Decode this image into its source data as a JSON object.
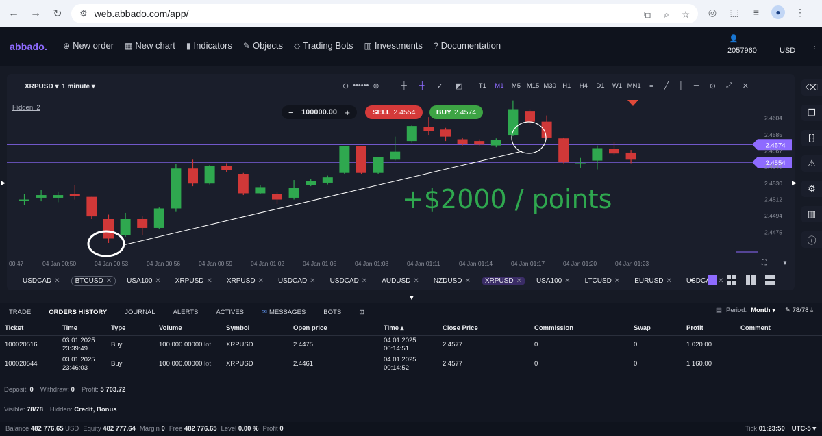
{
  "browser": {
    "url": "web.abbado.com/app/"
  },
  "app": {
    "logo": "abbado.",
    "menu": [
      {
        "icon": "⊕",
        "label": "New order"
      },
      {
        "icon": "▦",
        "label": "New chart"
      },
      {
        "icon": "▮",
        "label": "Indicators"
      },
      {
        "icon": "✎",
        "label": "Objects"
      },
      {
        "icon": "◇",
        "label": "Trading Bots"
      },
      {
        "icon": "▥",
        "label": "Investments"
      },
      {
        "icon": "?",
        "label": "Documentation"
      }
    ],
    "account_id": "2057960",
    "currency": "USD"
  },
  "chart": {
    "symbol": "XRPUSD",
    "interval": "1 minute",
    "timeframes": [
      "T1",
      "M1",
      "M5",
      "M15",
      "M30",
      "H1",
      "H4",
      "D1",
      "W1",
      "MN1"
    ],
    "selected_timeframe": "M1",
    "hidden_label": "Hidden: 2",
    "lot": "100000.00",
    "sell_label": "SELL",
    "sell_price": "2.4554",
    "buy_label": "BUY",
    "buy_price": "2.4574",
    "annotation": "+$2000 / points",
    "colors": {
      "up": "#2fa84f",
      "down": "#d03838",
      "line": "#8e6bff"
    }
  },
  "chart_data": {
    "type": "candlestick",
    "title": "",
    "x_ticks": [
      "00:47",
      "04 Jan 00:50",
      "04 Jan 00:53",
      "04 Jan 00:56",
      "04 Jan 00:59",
      "04 Jan 01:02",
      "04 Jan 01:05",
      "04 Jan 01:08",
      "04 Jan 01:11",
      "04 Jan 01:14",
      "04 Jan 01:17",
      "04 Jan 01:20",
      "04 Jan 01:23"
    ],
    "y_ticks": [
      "2.4604",
      "2.4585",
      "2.4567",
      "2.4549",
      "2.4530",
      "2.4512",
      "2.4494",
      "2.4475"
    ],
    "price_lines": [
      {
        "label": "2.4574",
        "value": 2.4574
      },
      {
        "label": "2.4554",
        "value": 2.4554
      }
    ],
    "candles": [
      {
        "o": 2.4512,
        "c": 2.4512,
        "h": 2.4518,
        "l": 2.4506
      },
      {
        "o": 2.4514,
        "c": 2.4517,
        "h": 2.4523,
        "l": 2.451
      },
      {
        "o": 2.4514,
        "c": 2.4517,
        "h": 2.4521,
        "l": 2.4509
      },
      {
        "o": 2.4518,
        "c": 2.4516,
        "h": 2.4528,
        "l": 2.4512
      },
      {
        "o": 2.4515,
        "c": 2.4493,
        "h": 2.4515,
        "l": 2.449
      },
      {
        "o": 2.449,
        "c": 2.4468,
        "h": 2.4495,
        "l": 2.4463
      },
      {
        "o": 2.4472,
        "c": 2.449,
        "h": 2.4497,
        "l": 2.447
      },
      {
        "o": 2.449,
        "c": 2.448,
        "h": 2.4493,
        "l": 2.4472
      },
      {
        "o": 2.448,
        "c": 2.4502,
        "h": 2.4503,
        "l": 2.4479
      },
      {
        "o": 2.4502,
        "c": 2.4547,
        "h": 2.4552,
        "l": 2.4498
      },
      {
        "o": 2.4547,
        "c": 2.453,
        "h": 2.4557,
        "l": 2.4527
      },
      {
        "o": 2.453,
        "c": 2.455,
        "h": 2.4551,
        "l": 2.4529
      },
      {
        "o": 2.455,
        "c": 2.4545,
        "h": 2.4553,
        "l": 2.4543
      },
      {
        "o": 2.4541,
        "c": 2.4519,
        "h": 2.4542,
        "l": 2.4517
      },
      {
        "o": 2.4519,
        "c": 2.4526,
        "h": 2.4528,
        "l": 2.4518
      },
      {
        "o": 2.4518,
        "c": 2.4512,
        "h": 2.452,
        "l": 2.4507
      },
      {
        "o": 2.4514,
        "c": 2.4525,
        "h": 2.4534,
        "l": 2.4512
      },
      {
        "o": 2.4528,
        "c": 2.4533,
        "h": 2.4535,
        "l": 2.4527
      },
      {
        "o": 2.4531,
        "c": 2.4537,
        "h": 2.4539,
        "l": 2.4529
      },
      {
        "o": 2.4542,
        "c": 2.4572,
        "h": 2.4572,
        "l": 2.4541
      },
      {
        "o": 2.4572,
        "c": 2.4542,
        "h": 2.4572,
        "l": 2.4541
      },
      {
        "o": 2.4542,
        "c": 2.456,
        "h": 2.456,
        "l": 2.4541
      },
      {
        "o": 2.4557,
        "c": 2.4566,
        "h": 2.4583,
        "l": 2.4556
      },
      {
        "o": 2.4578,
        "c": 2.4595,
        "h": 2.4596,
        "l": 2.4576
      },
      {
        "o": 2.4594,
        "c": 2.4589,
        "h": 2.4605,
        "l": 2.4585
      },
      {
        "o": 2.4591,
        "c": 2.4583,
        "h": 2.4593,
        "l": 2.4578
      },
      {
        "o": 2.458,
        "c": 2.4575,
        "h": 2.4582,
        "l": 2.4573
      },
      {
        "o": 2.4578,
        "c": 2.4574,
        "h": 2.458,
        "l": 2.4573
      },
      {
        "o": 2.4573,
        "c": 2.4579,
        "h": 2.4581,
        "l": 2.4571
      },
      {
        "o": 2.4585,
        "c": 2.4614,
        "h": 2.4624,
        "l": 2.4584
      },
      {
        "o": 2.4612,
        "c": 2.46,
        "h": 2.4614,
        "l": 2.4596
      },
      {
        "o": 2.46,
        "c": 2.4582,
        "h": 2.4607,
        "l": 2.458
      },
      {
        "o": 2.4581,
        "c": 2.4554,
        "h": 2.4582,
        "l": 2.4553
      },
      {
        "o": 2.4553,
        "c": 2.4553,
        "h": 2.4559,
        "l": 2.4548
      },
      {
        "o": 2.4556,
        "c": 2.457,
        "h": 2.4573,
        "l": 2.4546
      },
      {
        "o": 2.4569,
        "c": 2.4564,
        "h": 2.4577,
        "l": 2.4562
      },
      {
        "o": 2.4565,
        "c": 2.4557,
        "h": 2.4568,
        "l": 2.4553
      }
    ]
  },
  "symbol_tabs": [
    {
      "label": "USDCAD",
      "state": "normal"
    },
    {
      "label": "BTCUSD",
      "state": "outlined"
    },
    {
      "label": "USA100",
      "state": "normal"
    },
    {
      "label": "XRPUSD",
      "state": "normal"
    },
    {
      "label": "XRPUSD",
      "state": "normal"
    },
    {
      "label": "USDCAD",
      "state": "normal"
    },
    {
      "label": "USDCAD",
      "state": "normal"
    },
    {
      "label": "AUDUSD",
      "state": "normal"
    },
    {
      "label": "NZDUSD",
      "state": "normal"
    },
    {
      "label": "XRPUSD",
      "state": "selected"
    },
    {
      "label": "USA100",
      "state": "normal"
    },
    {
      "label": "LTCUSD",
      "state": "normal"
    },
    {
      "label": "EURUSD",
      "state": "normal"
    },
    {
      "label": "USDCAD",
      "state": "normal"
    }
  ],
  "bottom": {
    "tabs": [
      "TRADE",
      "ORDERS HISTORY",
      "JOURNAL",
      "ALERTS",
      "ACTIVES",
      "MESSAGES",
      "BOTS"
    ],
    "active_tab": "ORDERS HISTORY",
    "period_label": "Period:",
    "period_value": "Month",
    "count": "78/78",
    "columns": [
      "Ticket",
      "Time",
      "Type",
      "Volume",
      "Symbol",
      "Open price",
      "Time",
      "Close Price",
      "Commission",
      "Swap",
      "Profit",
      "Comment"
    ],
    "rows": [
      {
        "ticket": "100020516",
        "time1": "03.01.2025",
        "time2": "23:39:49",
        "type": "Buy",
        "volume": "100 000.00000",
        "lot": "lot",
        "symbol": "XRPUSD",
        "open": "2.4475",
        "ctime1": "04.01.2025",
        "ctime2": "00:14:51",
        "close": "2.4577",
        "commission": "0",
        "swap": "0",
        "profit": "1 020.00",
        "comment": ""
      },
      {
        "ticket": "100020544",
        "time1": "03.01.2025",
        "time2": "23:46:03",
        "type": "Buy",
        "volume": "100 000.00000",
        "lot": "lot",
        "symbol": "XRPUSD",
        "open": "2.4461",
        "ctime1": "04.01.2025",
        "ctime2": "00:14:52",
        "close": "2.4577",
        "commission": "0",
        "swap": "0",
        "profit": "1 160.00",
        "comment": ""
      }
    ],
    "deposit_label": "Deposit:",
    "deposit": "0",
    "withdraw_label": "Withdraw:",
    "withdraw": "0",
    "profit_label": "Profit:",
    "profit": "5 703.72",
    "visible_label": "Visible:",
    "visible": "78/78",
    "hidden_label": "Hidden:",
    "hidden": "Credit, Bonus"
  },
  "status": {
    "balance_label": "Balance",
    "balance": "482 776.65",
    "balance_cur": "USD",
    "equity_label": "Equity",
    "equity": "482 777.64",
    "margin_label": "Margin",
    "margin": "0",
    "free_label": "Free",
    "free": "482 776.65",
    "level_label": "Level",
    "level": "0.00 %",
    "profit_label": "Profit",
    "profit": "0",
    "tick_label": "Tick",
    "tick": "01:23:50",
    "timezone": "UTC-5"
  }
}
